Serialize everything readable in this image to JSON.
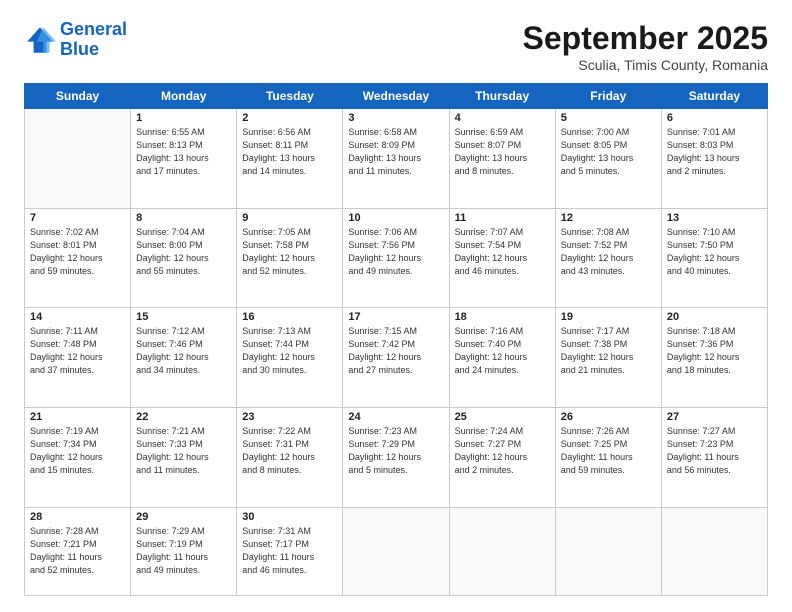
{
  "logo": {
    "line1": "General",
    "line2": "Blue"
  },
  "header": {
    "month": "September 2025",
    "location": "Sculia, Timis County, Romania"
  },
  "days_of_week": [
    "Sunday",
    "Monday",
    "Tuesday",
    "Wednesday",
    "Thursday",
    "Friday",
    "Saturday"
  ],
  "weeks": [
    [
      {
        "day": "",
        "info": ""
      },
      {
        "day": "1",
        "info": "Sunrise: 6:55 AM\nSunset: 8:13 PM\nDaylight: 13 hours\nand 17 minutes."
      },
      {
        "day": "2",
        "info": "Sunrise: 6:56 AM\nSunset: 8:11 PM\nDaylight: 13 hours\nand 14 minutes."
      },
      {
        "day": "3",
        "info": "Sunrise: 6:58 AM\nSunset: 8:09 PM\nDaylight: 13 hours\nand 11 minutes."
      },
      {
        "day": "4",
        "info": "Sunrise: 6:59 AM\nSunset: 8:07 PM\nDaylight: 13 hours\nand 8 minutes."
      },
      {
        "day": "5",
        "info": "Sunrise: 7:00 AM\nSunset: 8:05 PM\nDaylight: 13 hours\nand 5 minutes."
      },
      {
        "day": "6",
        "info": "Sunrise: 7:01 AM\nSunset: 8:03 PM\nDaylight: 13 hours\nand 2 minutes."
      }
    ],
    [
      {
        "day": "7",
        "info": "Sunrise: 7:02 AM\nSunset: 8:01 PM\nDaylight: 12 hours\nand 59 minutes."
      },
      {
        "day": "8",
        "info": "Sunrise: 7:04 AM\nSunset: 8:00 PM\nDaylight: 12 hours\nand 55 minutes."
      },
      {
        "day": "9",
        "info": "Sunrise: 7:05 AM\nSunset: 7:58 PM\nDaylight: 12 hours\nand 52 minutes."
      },
      {
        "day": "10",
        "info": "Sunrise: 7:06 AM\nSunset: 7:56 PM\nDaylight: 12 hours\nand 49 minutes."
      },
      {
        "day": "11",
        "info": "Sunrise: 7:07 AM\nSunset: 7:54 PM\nDaylight: 12 hours\nand 46 minutes."
      },
      {
        "day": "12",
        "info": "Sunrise: 7:08 AM\nSunset: 7:52 PM\nDaylight: 12 hours\nand 43 minutes."
      },
      {
        "day": "13",
        "info": "Sunrise: 7:10 AM\nSunset: 7:50 PM\nDaylight: 12 hours\nand 40 minutes."
      }
    ],
    [
      {
        "day": "14",
        "info": "Sunrise: 7:11 AM\nSunset: 7:48 PM\nDaylight: 12 hours\nand 37 minutes."
      },
      {
        "day": "15",
        "info": "Sunrise: 7:12 AM\nSunset: 7:46 PM\nDaylight: 12 hours\nand 34 minutes."
      },
      {
        "day": "16",
        "info": "Sunrise: 7:13 AM\nSunset: 7:44 PM\nDaylight: 12 hours\nand 30 minutes."
      },
      {
        "day": "17",
        "info": "Sunrise: 7:15 AM\nSunset: 7:42 PM\nDaylight: 12 hours\nand 27 minutes."
      },
      {
        "day": "18",
        "info": "Sunrise: 7:16 AM\nSunset: 7:40 PM\nDaylight: 12 hours\nand 24 minutes."
      },
      {
        "day": "19",
        "info": "Sunrise: 7:17 AM\nSunset: 7:38 PM\nDaylight: 12 hours\nand 21 minutes."
      },
      {
        "day": "20",
        "info": "Sunrise: 7:18 AM\nSunset: 7:36 PM\nDaylight: 12 hours\nand 18 minutes."
      }
    ],
    [
      {
        "day": "21",
        "info": "Sunrise: 7:19 AM\nSunset: 7:34 PM\nDaylight: 12 hours\nand 15 minutes."
      },
      {
        "day": "22",
        "info": "Sunrise: 7:21 AM\nSunset: 7:33 PM\nDaylight: 12 hours\nand 11 minutes."
      },
      {
        "day": "23",
        "info": "Sunrise: 7:22 AM\nSunset: 7:31 PM\nDaylight: 12 hours\nand 8 minutes."
      },
      {
        "day": "24",
        "info": "Sunrise: 7:23 AM\nSunset: 7:29 PM\nDaylight: 12 hours\nand 5 minutes."
      },
      {
        "day": "25",
        "info": "Sunrise: 7:24 AM\nSunset: 7:27 PM\nDaylight: 12 hours\nand 2 minutes."
      },
      {
        "day": "26",
        "info": "Sunrise: 7:26 AM\nSunset: 7:25 PM\nDaylight: 11 hours\nand 59 minutes."
      },
      {
        "day": "27",
        "info": "Sunrise: 7:27 AM\nSunset: 7:23 PM\nDaylight: 11 hours\nand 56 minutes."
      }
    ],
    [
      {
        "day": "28",
        "info": "Sunrise: 7:28 AM\nSunset: 7:21 PM\nDaylight: 11 hours\nand 52 minutes."
      },
      {
        "day": "29",
        "info": "Sunrise: 7:29 AM\nSunset: 7:19 PM\nDaylight: 11 hours\nand 49 minutes."
      },
      {
        "day": "30",
        "info": "Sunrise: 7:31 AM\nSunset: 7:17 PM\nDaylight: 11 hours\nand 46 minutes."
      },
      {
        "day": "",
        "info": ""
      },
      {
        "day": "",
        "info": ""
      },
      {
        "day": "",
        "info": ""
      },
      {
        "day": "",
        "info": ""
      }
    ]
  ]
}
